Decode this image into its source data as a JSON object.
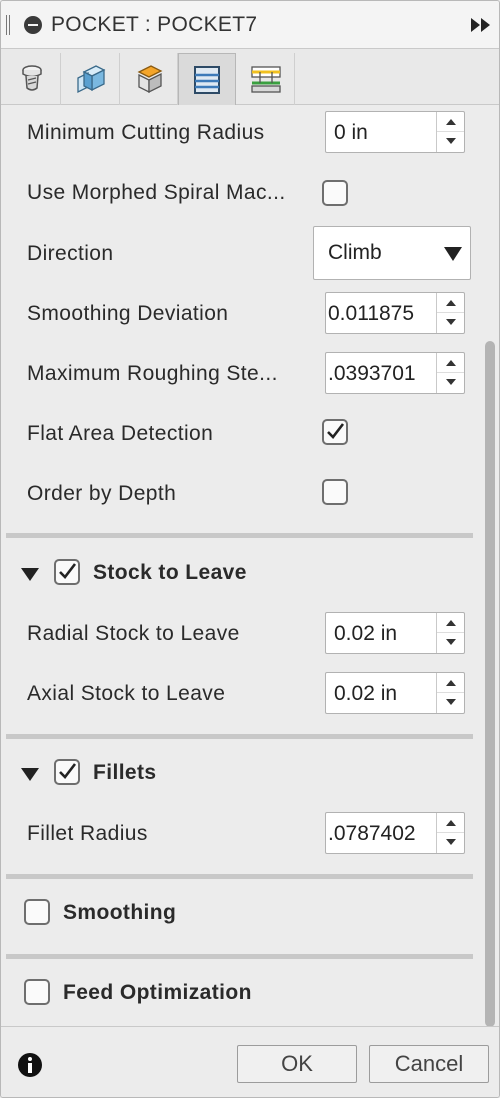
{
  "window": {
    "title": "POCKET : POCKET7"
  },
  "tabs": [
    {
      "name": "tool-tab"
    },
    {
      "name": "geometry-tab"
    },
    {
      "name": "heights-tab"
    },
    {
      "name": "passes-tab",
      "active": true
    },
    {
      "name": "linking-tab"
    }
  ],
  "fields": {
    "min_cutting_radius": {
      "label": "Minimum Cutting Radius",
      "value": "0 in"
    },
    "morphed_spiral": {
      "label": "Use Morphed Spiral Mac...",
      "checked": false
    },
    "direction": {
      "label": "Direction",
      "value": "Climb"
    },
    "smoothing_deviation": {
      "label": "Smoothing Deviation",
      "value": "0.011875"
    },
    "max_roughing_stepover": {
      "label": "Maximum Roughing Ste...",
      "value": ".0393701"
    },
    "flat_area_detection": {
      "label": "Flat Area Detection",
      "checked": true
    },
    "order_by_depth": {
      "label": "Order by Depth",
      "checked": false
    }
  },
  "stock_to_leave": {
    "title": "Stock to Leave",
    "checked": true,
    "radial": {
      "label": "Radial Stock to Leave",
      "value": "0.02 in"
    },
    "axial": {
      "label": "Axial Stock to Leave",
      "value": "0.02 in"
    }
  },
  "fillets": {
    "title": "Fillets",
    "checked": true,
    "radius": {
      "label": "Fillet Radius",
      "value": ".0787402"
    }
  },
  "smoothing": {
    "title": "Smoothing",
    "checked": false
  },
  "feed_optimization": {
    "title": "Feed Optimization",
    "checked": false
  },
  "footer": {
    "ok_label": "OK",
    "cancel_label": "Cancel"
  }
}
